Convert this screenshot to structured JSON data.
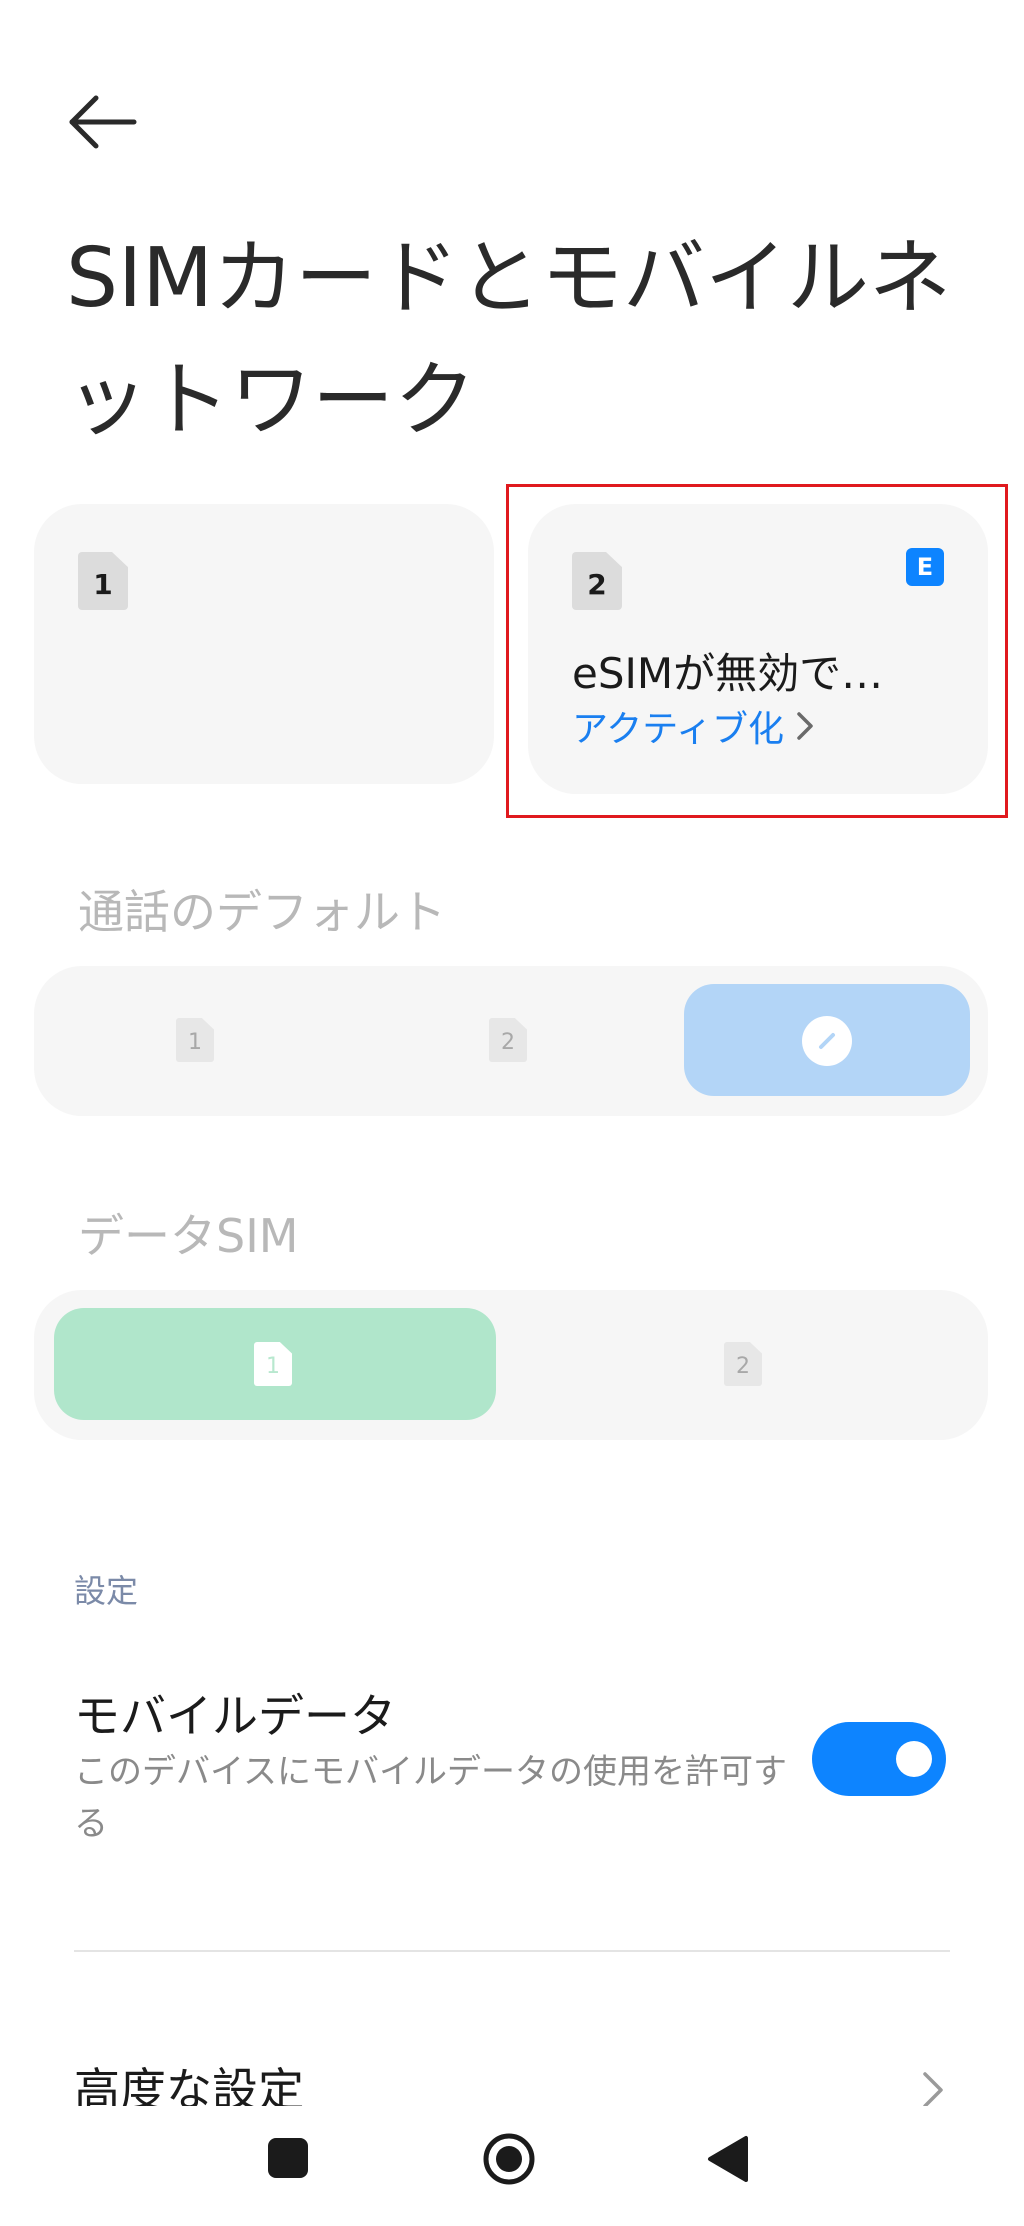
{
  "page": {
    "title": "SIMカードとモバイルネットワーク"
  },
  "sims": [
    {
      "slot": "1"
    },
    {
      "slot": "2",
      "badge": "E",
      "status": "eSIMが無効で…",
      "action": "アクティブ化"
    }
  ],
  "call_default": {
    "label": "通話のデフォルト",
    "options": [
      "1",
      "2",
      "ask-every-time-icon"
    ],
    "selected": 2
  },
  "data_sim": {
    "label": "データSIM",
    "options": [
      "1",
      "2"
    ],
    "selected": 0
  },
  "settings": {
    "section_label": "設定",
    "mobile_data": {
      "title": "モバイルデータ",
      "description": "このデバイスにモバイルデータの使用を許可する",
      "enabled": true
    },
    "advanced": "高度な設定"
  },
  "colors": {
    "accent": "#0d84ff",
    "highlight_border": "#e0191e",
    "call_selected": "#b3d5f7",
    "data_selected": "#b0e6cb"
  }
}
